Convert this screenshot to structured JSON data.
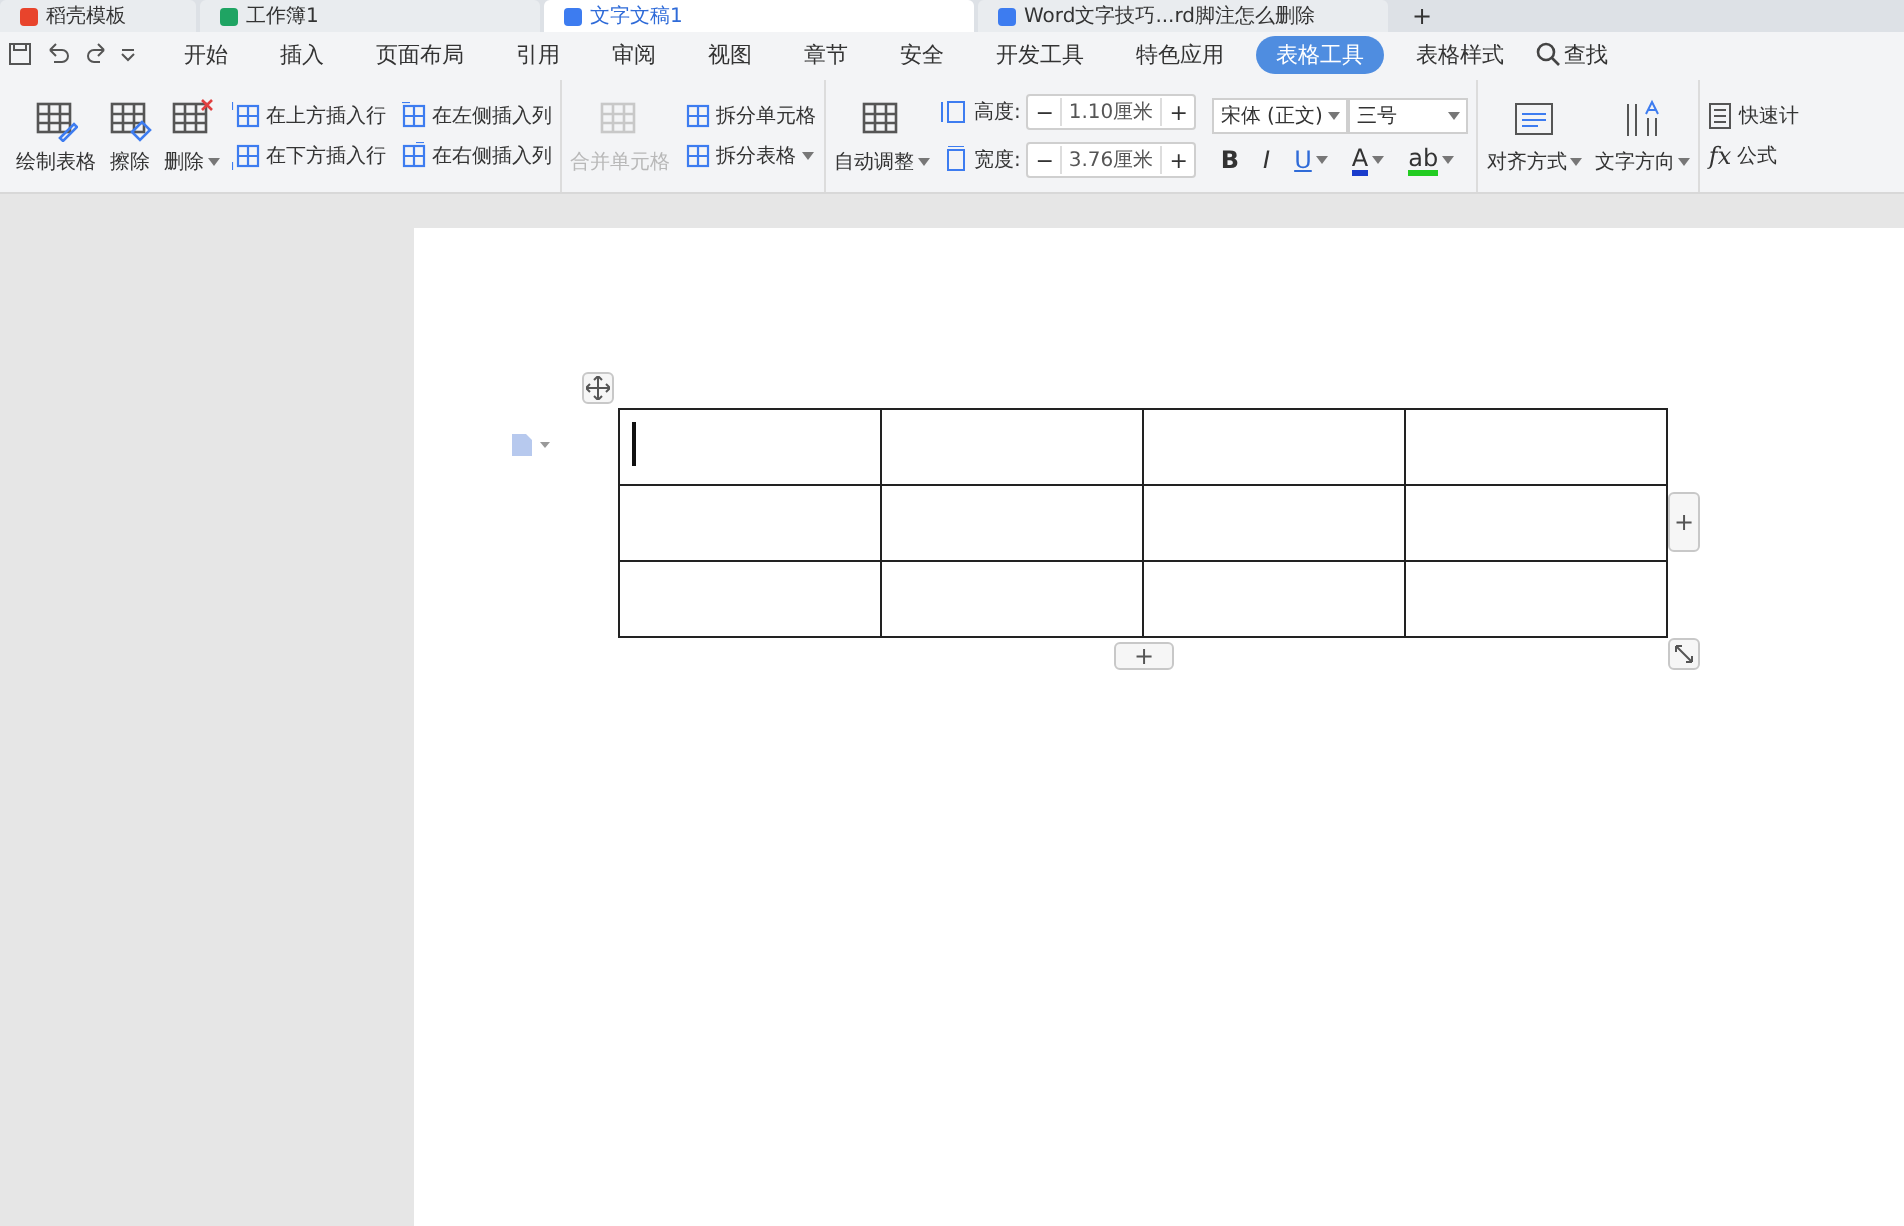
{
  "browser_tabs": [
    {
      "label": "稻壳模板",
      "color": "#e8442c",
      "selected": false
    },
    {
      "label": "工作簿1",
      "color": "#1fa463",
      "selected": false
    },
    {
      "label": "文字文稿1",
      "color": "#3d7cf0",
      "selected": true
    },
    {
      "label": "Word文字技巧...rd脚注怎么删除",
      "color": "#3d7cf0",
      "selected": false
    }
  ],
  "new_tab": "+",
  "menu_tabs": [
    {
      "label": "开始",
      "selected": false
    },
    {
      "label": "插入",
      "selected": false
    },
    {
      "label": "页面布局",
      "selected": false
    },
    {
      "label": "引用",
      "selected": false
    },
    {
      "label": "审阅",
      "selected": false
    },
    {
      "label": "视图",
      "selected": false
    },
    {
      "label": "章节",
      "selected": false
    },
    {
      "label": "安全",
      "selected": false
    },
    {
      "label": "开发工具",
      "selected": false
    },
    {
      "label": "特色应用",
      "selected": false
    },
    {
      "label": "表格工具",
      "selected": true
    },
    {
      "label": "表格样式",
      "selected": false
    }
  ],
  "search": {
    "label": "查找"
  },
  "ribbon": {
    "draw_table": {
      "label": "绘制表格"
    },
    "erase": {
      "label": "擦除"
    },
    "delete": {
      "label": "删除",
      "dropdown": true
    },
    "insert": [
      {
        "label": "在上方插入行",
        "kind": "row_above"
      },
      {
        "label": "在下方插入行",
        "kind": "row_below"
      },
      {
        "label": "在左侧插入列",
        "kind": "col_left"
      },
      {
        "label": "在右侧插入列",
        "kind": "col_right"
      }
    ],
    "merge": {
      "label": "合并单元格",
      "disabled": true
    },
    "split_cell": {
      "label": "拆分单元格"
    },
    "split_table": {
      "label": "拆分表格",
      "dropdown": true
    },
    "auto_fit": {
      "label": "自动调整",
      "dropdown": true
    },
    "sizes": [
      {
        "label": "高度:",
        "value": "1.10厘米",
        "minus": "−",
        "plus": "+",
        "kind": "height"
      },
      {
        "label": "宽度:",
        "value": "3.76厘米",
        "minus": "−",
        "plus": "+",
        "kind": "width"
      }
    ],
    "font": {
      "family": "宋体 (正文)",
      "size": "三号"
    },
    "format": [
      {
        "kind": "bold",
        "label": "B"
      },
      {
        "kind": "italic",
        "label": "I"
      },
      {
        "kind": "underline",
        "label": "U"
      },
      {
        "kind": "font_color",
        "label": "A",
        "color": "#1a3ccc"
      },
      {
        "kind": "highlight",
        "label": "ab",
        "color": "#22cc22"
      }
    ],
    "align": {
      "label": "对齐方式",
      "dropdown": true
    },
    "text_direction": {
      "label": "文字方向",
      "dropdown": true
    },
    "quick_calc": {
      "label": "快速计"
    },
    "formula": {
      "icon_text": "fx",
      "label": "公式"
    }
  },
  "document": {
    "table": {
      "rows": [
        {
          "cells": [
            {
              "cursor": true
            },
            {
              "cursor": false
            },
            {
              "cursor": false
            },
            {
              "cursor": false
            }
          ]
        },
        {
          "cells": [
            {
              "cursor": false
            },
            {
              "cursor": false
            },
            {
              "cursor": false
            },
            {
              "cursor": false
            }
          ]
        },
        {
          "cells": [
            {
              "cursor": false
            },
            {
              "cursor": false
            },
            {
              "cursor": false
            },
            {
              "cursor": false
            }
          ]
        }
      ]
    },
    "add_row": "+",
    "add_column": "+"
  }
}
